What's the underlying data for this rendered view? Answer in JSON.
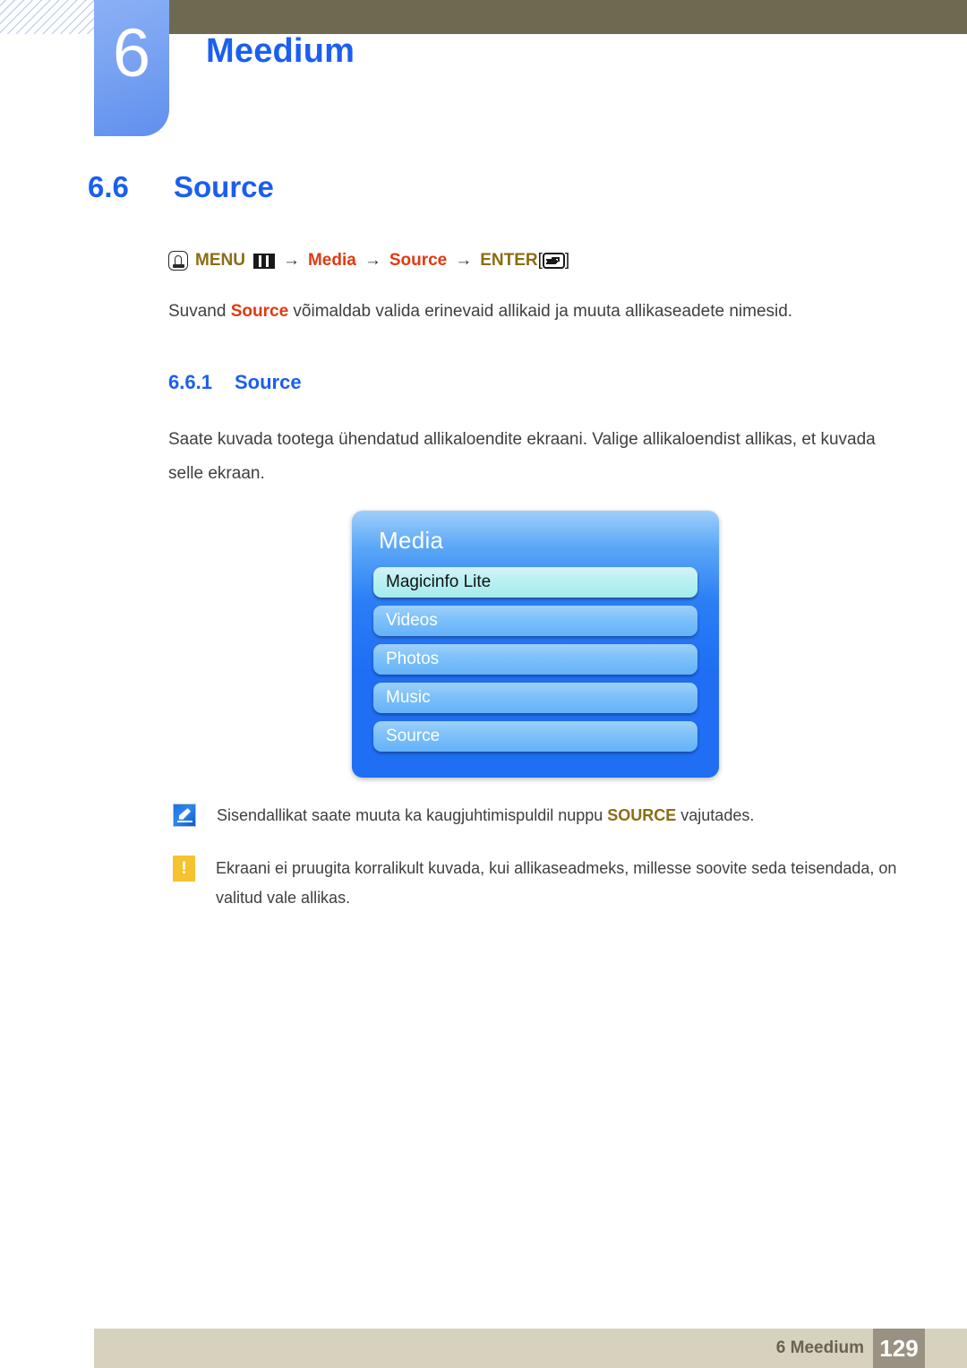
{
  "header": {
    "chapter_number": "6",
    "chapter_title": "Meedium"
  },
  "section": {
    "number": "6.6",
    "title": "Source"
  },
  "menu_path": {
    "menu_label": "MENU",
    "arrow": "→",
    "item1": "Media",
    "item2": "Source",
    "enter_label": "ENTER",
    "bracket_open": "[",
    "bracket_close": "]"
  },
  "intro": {
    "before": "Suvand ",
    "highlight": "Source",
    "after": " võimaldab valida erinevaid allikaid ja muuta allikaseadete nimesid."
  },
  "subsection": {
    "number": "6.6.1",
    "title": "Source"
  },
  "description": "Saate kuvada tootega ühendatud allikaloendite ekraani. Valige allikaloendist allikas, et kuvada selle ekraan.",
  "osd": {
    "title": "Media",
    "items": [
      {
        "label": "Magicinfo Lite",
        "selected": true
      },
      {
        "label": "Videos",
        "selected": false
      },
      {
        "label": "Photos",
        "selected": false
      },
      {
        "label": "Music",
        "selected": false
      },
      {
        "label": "Source",
        "selected": false
      }
    ]
  },
  "notes": [
    {
      "icon": "note-pencil-icon",
      "before": "Sisendallikat saate muuta ka kaugjuhtimispuldil nuppu ",
      "highlight": "SOURCE",
      "after": " vajutades."
    },
    {
      "icon": "warning-icon",
      "glyph": "!",
      "text": "Ekraani ei pruugita korralikult kuvada, kui allikaseadmeks, millesse soovite seda teisendada, on valitud vale allikas."
    }
  ],
  "footer": {
    "label": "6 Meedium",
    "page_number": "129"
  },
  "colors": {
    "accent_blue": "#1b5ff0",
    "accent_red": "#e03a10",
    "accent_gold": "#8a6d14",
    "header_bar": "#6e6a51",
    "footer_bar": "#d7d2be",
    "footer_page_box": "#9b9183",
    "warning": "#f5c330",
    "osd_blue": "#1f6ef4"
  }
}
